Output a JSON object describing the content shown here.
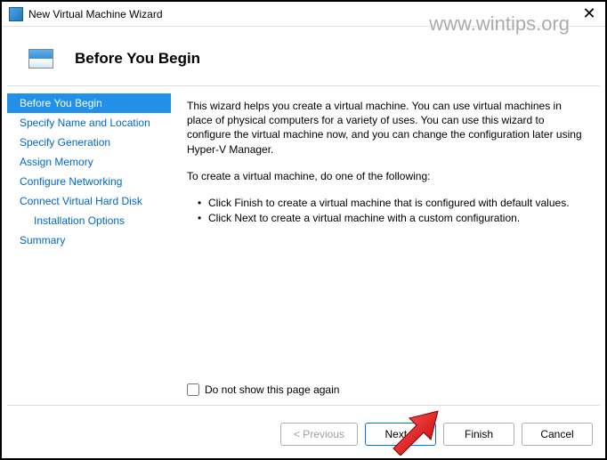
{
  "window": {
    "title": "New Virtual Machine Wizard"
  },
  "watermark": "www.wintips.org",
  "header": {
    "title": "Before You Begin"
  },
  "sidebar": {
    "items": [
      {
        "label": "Before You Begin",
        "active": true
      },
      {
        "label": "Specify Name and Location"
      },
      {
        "label": "Specify Generation"
      },
      {
        "label": "Assign Memory"
      },
      {
        "label": "Configure Networking"
      },
      {
        "label": "Connect Virtual Hard Disk"
      },
      {
        "label": "Installation Options",
        "indent": true
      },
      {
        "label": "Summary"
      }
    ]
  },
  "main": {
    "intro": "This wizard helps you create a virtual machine. You can use virtual machines in place of physical computers for a variety of uses. You can use this wizard to configure the virtual machine now, and you can change the configuration later using Hyper-V Manager.",
    "lead": "To create a virtual machine, do one of the following:",
    "bullets": [
      "Click Finish to create a virtual machine that is configured with default values.",
      "Click Next to create a virtual machine with a custom configuration."
    ],
    "checkbox_label": "Do not show this page again"
  },
  "buttons": {
    "previous": "< Previous",
    "next": "Next >",
    "finish": "Finish",
    "cancel": "Cancel"
  }
}
